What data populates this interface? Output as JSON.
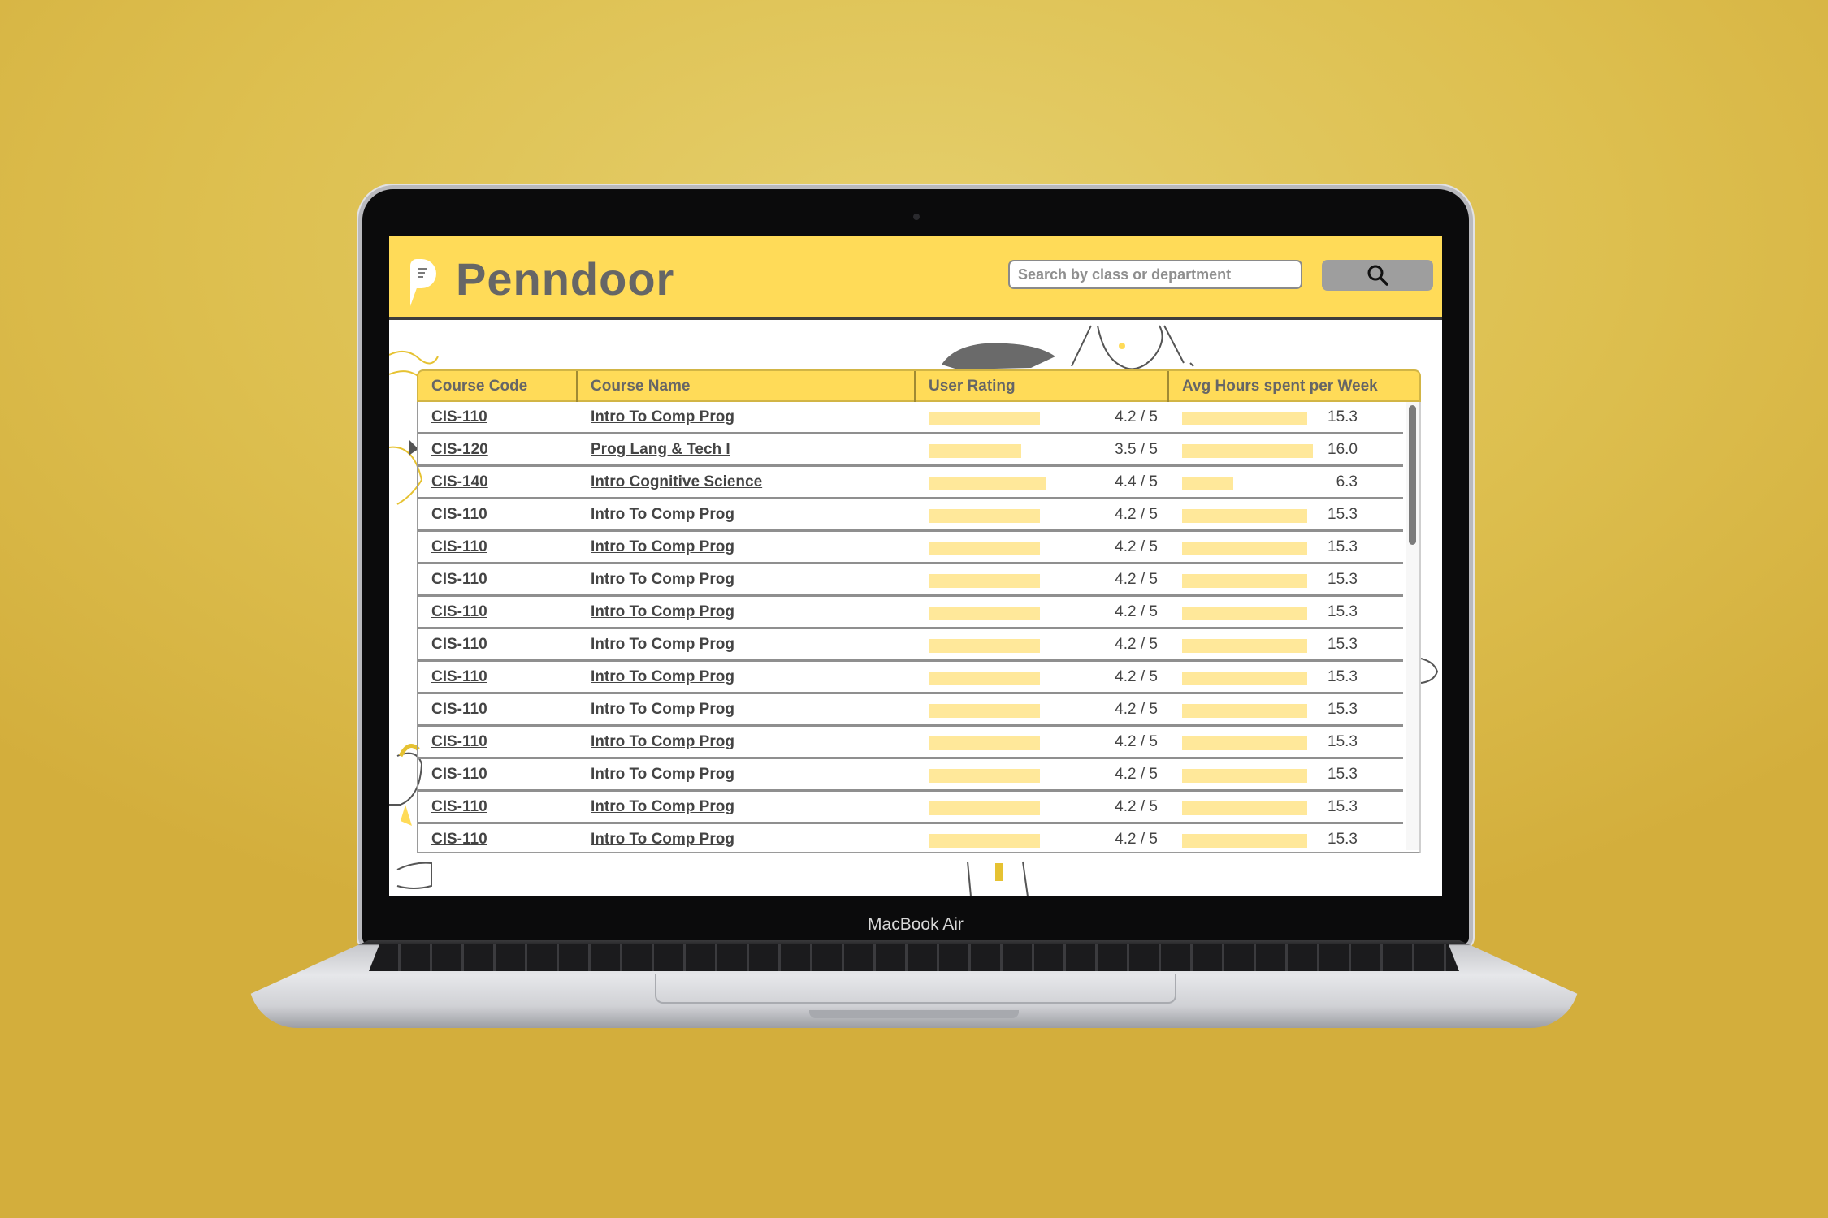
{
  "device": {
    "model_label": "MacBook Air"
  },
  "header": {
    "brand": "Penndoor",
    "search_placeholder": "Search by class or department",
    "search_icon": "search-icon"
  },
  "table": {
    "columns": [
      "Course Code",
      "Course Name",
      "User Rating",
      "Avg Hours spent per Week"
    ],
    "rating_max": 5,
    "hours_max": 16.5,
    "rows": [
      {
        "code": "CIS-110",
        "name": "Intro To Comp Prog",
        "rating": 4.2,
        "rating_text": "4.2 / 5",
        "hours": 15.3,
        "hours_text": "15.3"
      },
      {
        "code": "CIS-120",
        "name": "Prog Lang & Tech I",
        "rating": 3.5,
        "rating_text": "3.5 / 5",
        "hours": 16.0,
        "hours_text": "16.0"
      },
      {
        "code": "CIS-140",
        "name": "Intro Cognitive Science",
        "rating": 4.4,
        "rating_text": "4.4 / 5",
        "hours": 6.3,
        "hours_text": "6.3"
      },
      {
        "code": "CIS-110",
        "name": "Intro To Comp Prog",
        "rating": 4.2,
        "rating_text": "4.2 / 5",
        "hours": 15.3,
        "hours_text": "15.3"
      },
      {
        "code": "CIS-110",
        "name": "Intro To Comp Prog",
        "rating": 4.2,
        "rating_text": "4.2 / 5",
        "hours": 15.3,
        "hours_text": "15.3"
      },
      {
        "code": "CIS-110",
        "name": "Intro To Comp Prog",
        "rating": 4.2,
        "rating_text": "4.2 / 5",
        "hours": 15.3,
        "hours_text": "15.3"
      },
      {
        "code": "CIS-110",
        "name": "Intro To Comp Prog",
        "rating": 4.2,
        "rating_text": "4.2 / 5",
        "hours": 15.3,
        "hours_text": "15.3"
      },
      {
        "code": "CIS-110",
        "name": "Intro To Comp Prog",
        "rating": 4.2,
        "rating_text": "4.2 / 5",
        "hours": 15.3,
        "hours_text": "15.3"
      },
      {
        "code": "CIS-110",
        "name": "Intro To Comp Prog",
        "rating": 4.2,
        "rating_text": "4.2 / 5",
        "hours": 15.3,
        "hours_text": "15.3"
      },
      {
        "code": "CIS-110",
        "name": "Intro To Comp Prog",
        "rating": 4.2,
        "rating_text": "4.2 / 5",
        "hours": 15.3,
        "hours_text": "15.3"
      },
      {
        "code": "CIS-110",
        "name": "Intro To Comp Prog",
        "rating": 4.2,
        "rating_text": "4.2 / 5",
        "hours": 15.3,
        "hours_text": "15.3"
      },
      {
        "code": "CIS-110",
        "name": "Intro To Comp Prog",
        "rating": 4.2,
        "rating_text": "4.2 / 5",
        "hours": 15.3,
        "hours_text": "15.3"
      },
      {
        "code": "CIS-110",
        "name": "Intro To Comp Prog",
        "rating": 4.2,
        "rating_text": "4.2 / 5",
        "hours": 15.3,
        "hours_text": "15.3"
      },
      {
        "code": "CIS-110",
        "name": "Intro To Comp Prog",
        "rating": 4.2,
        "rating_text": "4.2 / 5",
        "hours": 15.3,
        "hours_text": "15.3"
      }
    ]
  },
  "colors": {
    "accent_yellow": "#ffdb58",
    "bar_fill": "#ffe89a",
    "search_button": "#9e9e9e",
    "background": "#ddbf4f"
  }
}
